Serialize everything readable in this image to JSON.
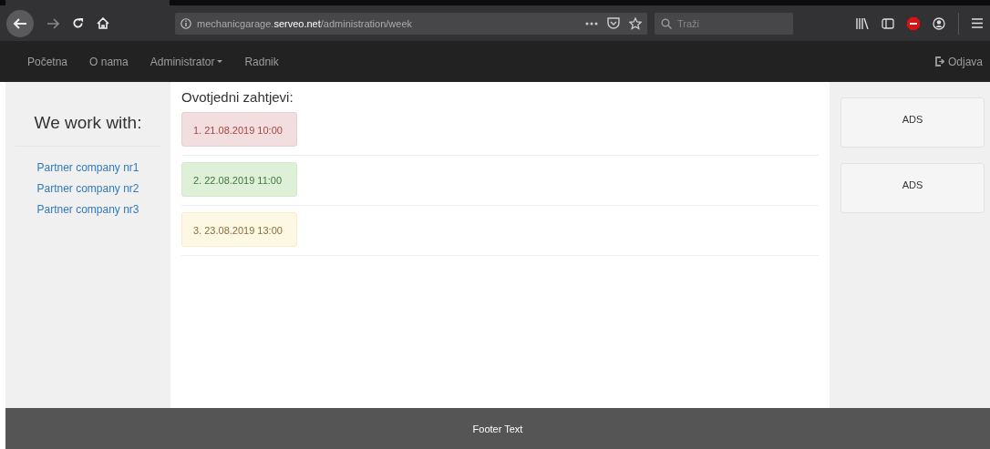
{
  "browser": {
    "url_prefix": "mechanicgarage.",
    "url_domain": "serveo.net",
    "url_path": "/administration/week",
    "search_placeholder": "Traži"
  },
  "navbar": {
    "items": [
      {
        "label": "Početna",
        "dropdown": false
      },
      {
        "label": "O nama",
        "dropdown": false
      },
      {
        "label": "Administrator",
        "dropdown": true
      },
      {
        "label": "Radnik",
        "dropdown": false
      }
    ],
    "logout": "Odjava"
  },
  "sidebar": {
    "title": "We work with:",
    "links": [
      "Partner company nr1",
      "Partner company nr2",
      "Partner company nr3"
    ]
  },
  "main": {
    "heading": "Ovotjedni zahtjevi:",
    "requests": [
      {
        "text": "1. 21.08.2019 10:00",
        "kind": "danger"
      },
      {
        "text": "2. 22.08.2019 11:00",
        "kind": "success"
      },
      {
        "text": "3. 23.08.2019 13:00",
        "kind": "warning"
      }
    ]
  },
  "ads": [
    "ADS",
    "ADS"
  ],
  "footer": "Footer Text"
}
